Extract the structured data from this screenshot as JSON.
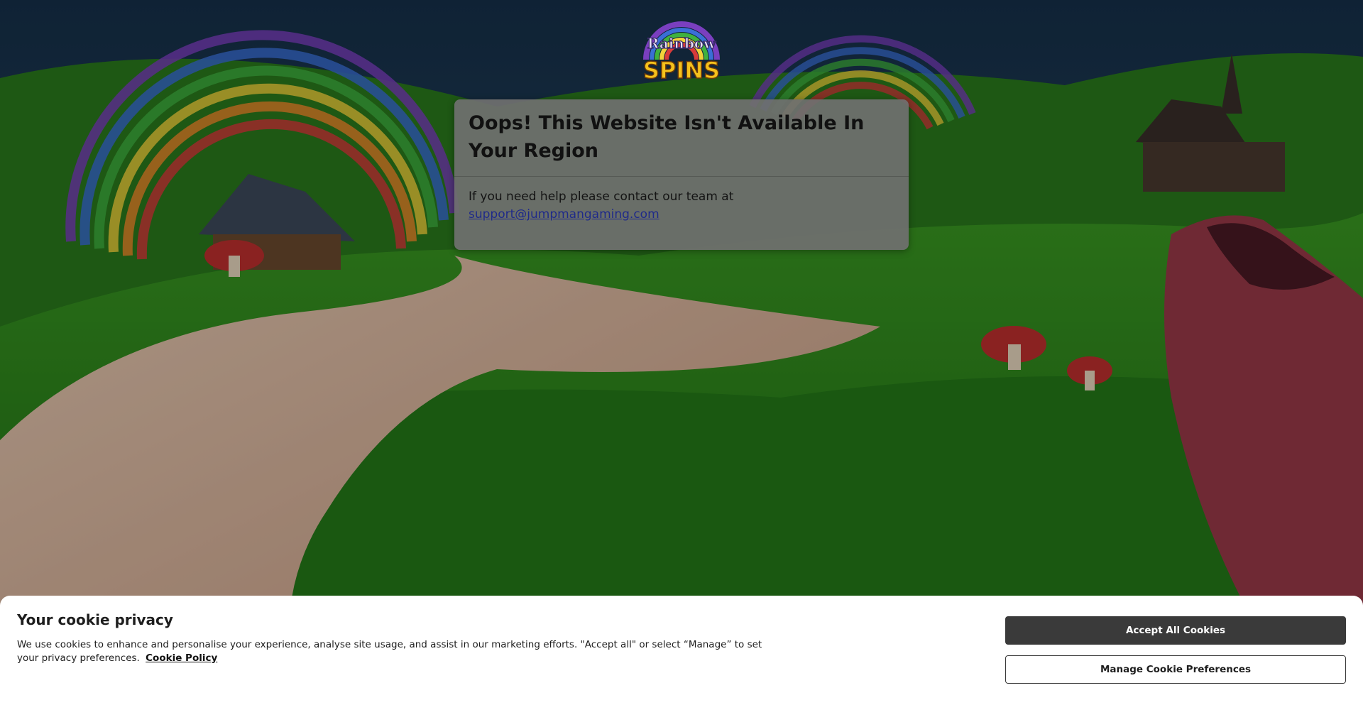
{
  "logo": {
    "top_text": "Rainbow",
    "bottom_text": "SPINS"
  },
  "modal": {
    "title": "Oops! This Website Isn't Available In Your Region",
    "message": "If you need help please contact our team at",
    "email": "support@jumpmangaming.com"
  },
  "cookie_banner": {
    "title": "Your cookie privacy",
    "text": "We use cookies to enhance and personalise your experience, analyse site usage, and assist in our marketing efforts. \"Accept all\" or select “Manage” to set your privacy preferences.",
    "policy_link": "Cookie Policy",
    "accept_label": "Accept All Cookies",
    "manage_label": "Manage Cookie Preferences"
  },
  "colors": {
    "sky": "#1e3a52",
    "grass": "#2f8a1e",
    "path": "#d9b8a0",
    "banner_button": "#3a3a3a"
  }
}
